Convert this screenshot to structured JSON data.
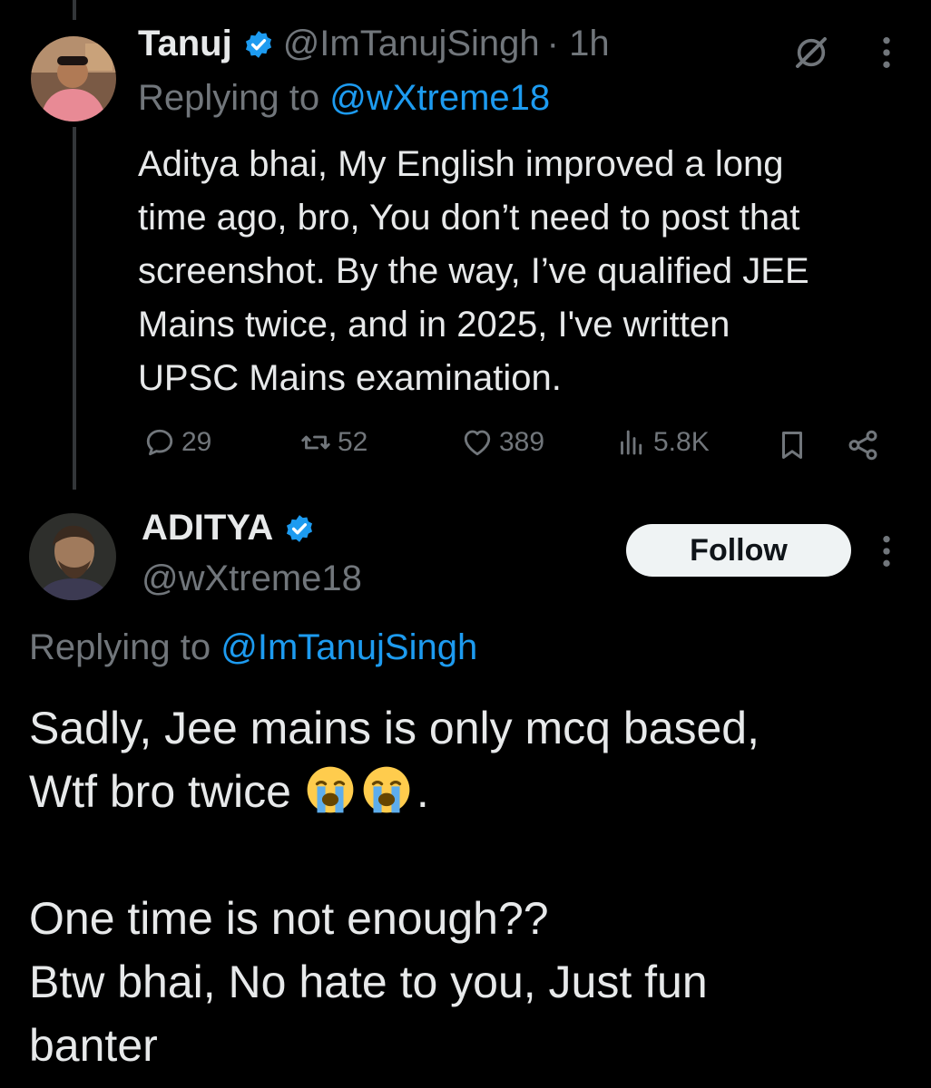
{
  "reply_tweet": {
    "author_name": "Tanuj",
    "handle": "@ImTanujSingh",
    "time": "· 1h",
    "replying_prefix": "Replying to",
    "replying_handle": "@wXtreme18",
    "body_lines": [
      "Aditya bhai, My English improved a long",
      "time ago, bro, You don’t need to post that",
      "screenshot. By the way, I’ve qualified JEE",
      "Mains twice, and in 2025, I've written",
      "UPSC Mains examination."
    ],
    "stats": {
      "replies": "29",
      "reposts": "52",
      "likes": "389",
      "views": "5.8K"
    }
  },
  "main_tweet": {
    "author_name": "ADITYA",
    "handle": "@wXtreme18",
    "follow_label": "Follow",
    "replying_prefix": "Replying to",
    "replying_handle": "@ImTanujSingh",
    "line1": "Sadly, Jee mains is only mcq based,",
    "line2_text": "Wtf bro twice",
    "line2_suffix": ".",
    "line3": "One time is not enough??",
    "line4": "Btw bhai, No hate to you, Just fun",
    "line5": "banter"
  },
  "icons": {
    "verified": "verified-badge-icon",
    "grok": "grok-icon",
    "more": "more-options-icon",
    "reply": "reply-icon",
    "repost": "repost-icon",
    "like": "heart-icon",
    "views": "views-icon",
    "bookmark": "bookmark-icon",
    "share": "share-icon",
    "emoji": "loudly-crying-face-icon"
  },
  "colors": {
    "background": "#000000",
    "text": "#e7e9ea",
    "muted": "#71767b",
    "accent": "#1d9bf0"
  }
}
